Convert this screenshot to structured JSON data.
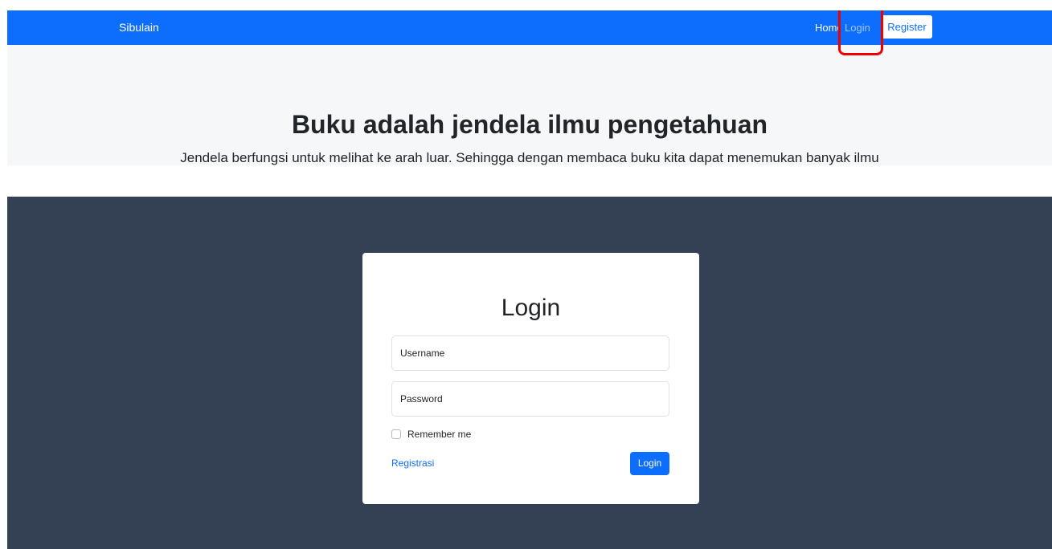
{
  "navbar": {
    "brand": "Sibulain",
    "items": [
      {
        "label": "Home"
      },
      {
        "label": "Login"
      }
    ],
    "register_label": "Register"
  },
  "hero": {
    "title": "Buku adalah jendela ilmu pengetahuan",
    "subtitle": "Jendela berfungsi untuk melihat ke arah luar. Sehingga dengan membaca buku kita dapat menemukan banyak ilmu"
  },
  "login_form": {
    "title": "Login",
    "username_placeholder": "Username",
    "password_placeholder": "Password",
    "remember_label": "Remember me",
    "register_link": "Registrasi",
    "submit_label": "Login"
  },
  "colors": {
    "primary": "#0d6efd",
    "background_dark": "#344154",
    "highlight": "#e00000"
  }
}
